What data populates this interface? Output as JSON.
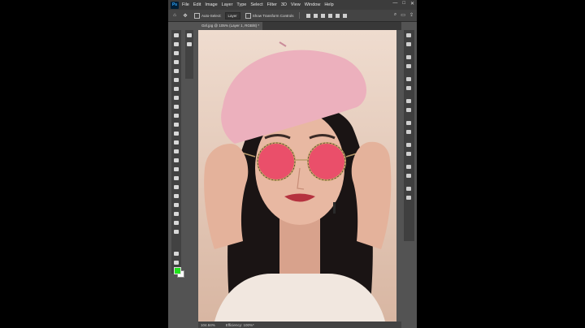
{
  "app": {
    "logo": "Ps"
  },
  "menu": [
    "File",
    "Edit",
    "Image",
    "Layer",
    "Type",
    "Select",
    "Filter",
    "3D",
    "View",
    "Window",
    "Help"
  ],
  "window_controls": [
    "—",
    "□",
    "✕"
  ],
  "options_bar": {
    "auto_select_label": "Auto-Select:",
    "layer_select": "Layer",
    "transform_label": "Show Transform Controls"
  },
  "document": {
    "tab_title": "Girl.jpg @ 105% (Layer 1, RGB/8) *"
  },
  "status": {
    "zoom": "104.84%",
    "efficiency": "Efficiency: 100%*"
  },
  "colors": {
    "foreground": "#21e21d",
    "background": "#ffffff",
    "lens_fill": "#ea4f6a"
  },
  "icons": {
    "tools": [
      "move-icon",
      "artboard-icon",
      "marquee-icon",
      "lasso-icon",
      "quick-select-icon",
      "crop-icon",
      "frame-icon",
      "eyedropper-icon",
      "spot-heal-icon",
      "brush-icon",
      "clone-stamp-icon",
      "history-brush-icon",
      "eraser-icon",
      "gradient-icon",
      "blur-icon",
      "dodge-icon",
      "pen-icon",
      "type-icon",
      "path-select-icon",
      "rectangle-icon",
      "hand-icon",
      "zoom-icon",
      "edit-toolbar-icon",
      "quick-mask-icon",
      "screen-mode-icon"
    ],
    "sidebar": [
      "collapse-icon",
      "layers-icon",
      "properties-icon"
    ],
    "right_panel": [
      "history-icon",
      "info-icon",
      "channels-icon",
      "paths-icon",
      "adjustments-icon",
      "styles-icon",
      "brushes-icon",
      "clone-source-icon",
      "character-icon",
      "paragraph-icon",
      "glyphs-icon",
      "notes-icon",
      "color-icon",
      "swatches-icon",
      "gradients-icon",
      "patterns-icon"
    ]
  }
}
